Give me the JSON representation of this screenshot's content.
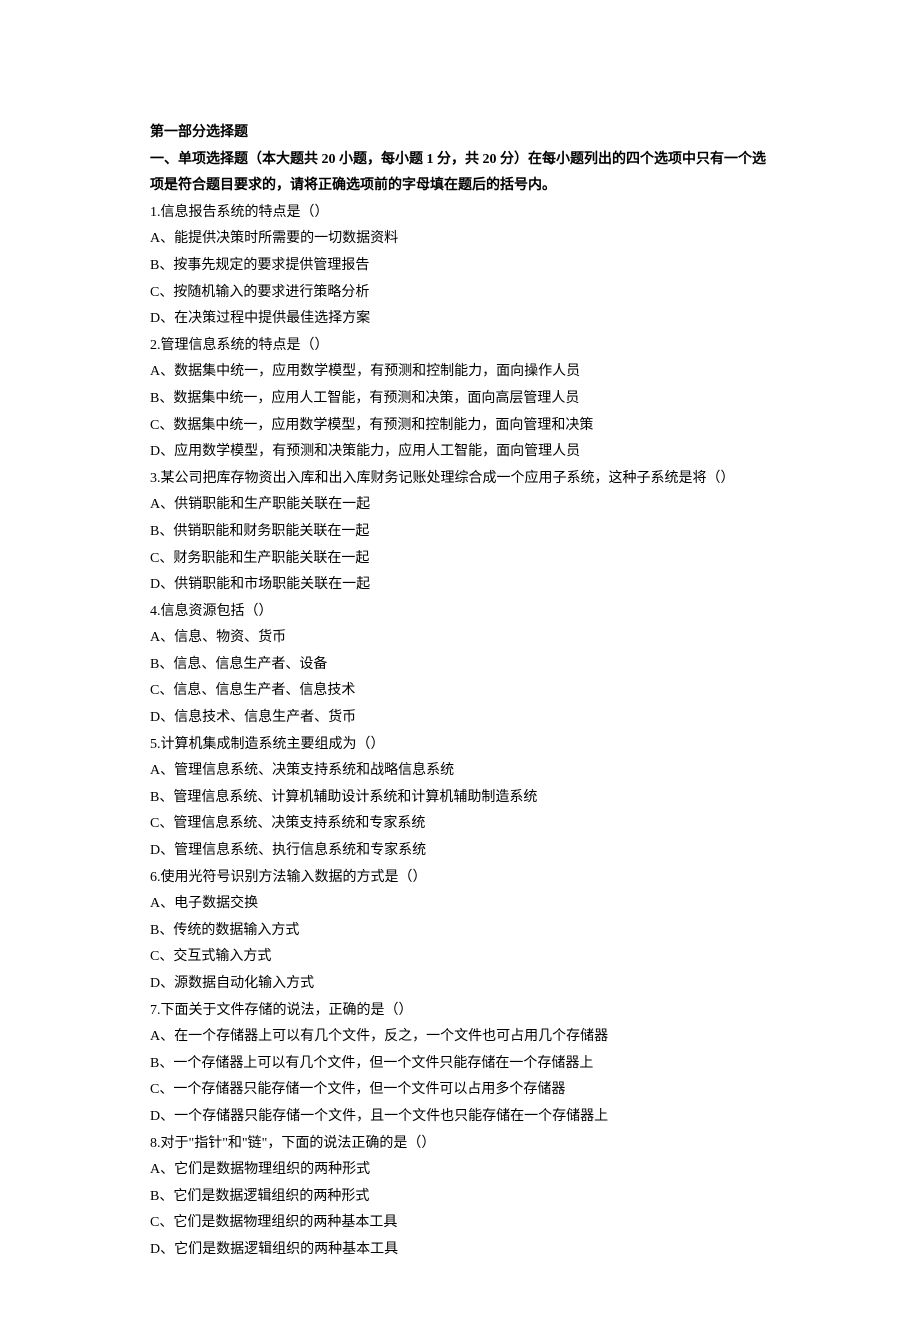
{
  "section_title": "第一部分选择题",
  "instructions": "一、单项选择题（本大题共 20 小题，每小题 1 分，共 20 分）在每小题列出的四个选项中只有一个选项是符合题目要求的，请将正确选项前的字母填在题后的括号内。",
  "questions": [
    {
      "stem": "1.信息报告系统的特点是（）",
      "options": [
        "A、能提供决策时所需要的一切数据资料",
        "B、按事先规定的要求提供管理报告",
        "C、按随机输入的要求进行策略分析",
        "D、在决策过程中提供最佳选择方案"
      ]
    },
    {
      "stem": "2.管理信息系统的特点是（）",
      "options": [
        "A、数据集中统一，应用数学模型，有预测和控制能力，面向操作人员",
        "B、数据集中统一，应用人工智能，有预测和决策，面向高层管理人员",
        "C、数据集中统一，应用数学模型，有预测和控制能力，面向管理和决策",
        "D、应用数学模型，有预测和决策能力，应用人工智能，面向管理人员"
      ]
    },
    {
      "stem": "3.某公司把库存物资出入库和出入库财务记账处理综合成一个应用子系统，这种子系统是将（）",
      "options": [
        "A、供销职能和生产职能关联在一起",
        "B、供销职能和财务职能关联在一起",
        "C、财务职能和生产职能关联在一起",
        "D、供销职能和市场职能关联在一起"
      ]
    },
    {
      "stem": "4.信息资源包括（）",
      "options": [
        "A、信息、物资、货币",
        "B、信息、信息生产者、设备",
        "C、信息、信息生产者、信息技术",
        "D、信息技术、信息生产者、货币"
      ]
    },
    {
      "stem": "5.计算机集成制造系统主要组成为（）",
      "options": [
        "A、管理信息系统、决策支持系统和战略信息系统",
        "B、管理信息系统、计算机辅助设计系统和计算机辅助制造系统",
        "C、管理信息系统、决策支持系统和专家系统",
        "D、管理信息系统、执行信息系统和专家系统"
      ]
    },
    {
      "stem": "6.使用光符号识别方法输入数据的方式是（）",
      "options": [
        "A、电子数据交换",
        "B、传统的数据输入方式",
        "C、交互式输入方式",
        "D、源数据自动化输入方式"
      ]
    },
    {
      "stem": "7.下面关于文件存储的说法，正确的是（）",
      "options": [
        "A、在一个存储器上可以有几个文件，反之，一个文件也可占用几个存储器",
        "B、一个存储器上可以有几个文件，但一个文件只能存储在一个存储器上",
        "C、一个存储器只能存储一个文件，但一个文件可以占用多个存储器",
        "D、一个存储器只能存储一个文件，且一个文件也只能存储在一个存储器上"
      ]
    },
    {
      "stem": "8.对于\"指针\"和\"链\"，下面的说法正确的是（）",
      "options": [
        "A、它们是数据物理组织的两种形式",
        "B、它们是数据逻辑组织的两种形式",
        "C、它们是数据物理组织的两种基本工具",
        "D、它们是数据逻辑组织的两种基本工具"
      ]
    }
  ]
}
